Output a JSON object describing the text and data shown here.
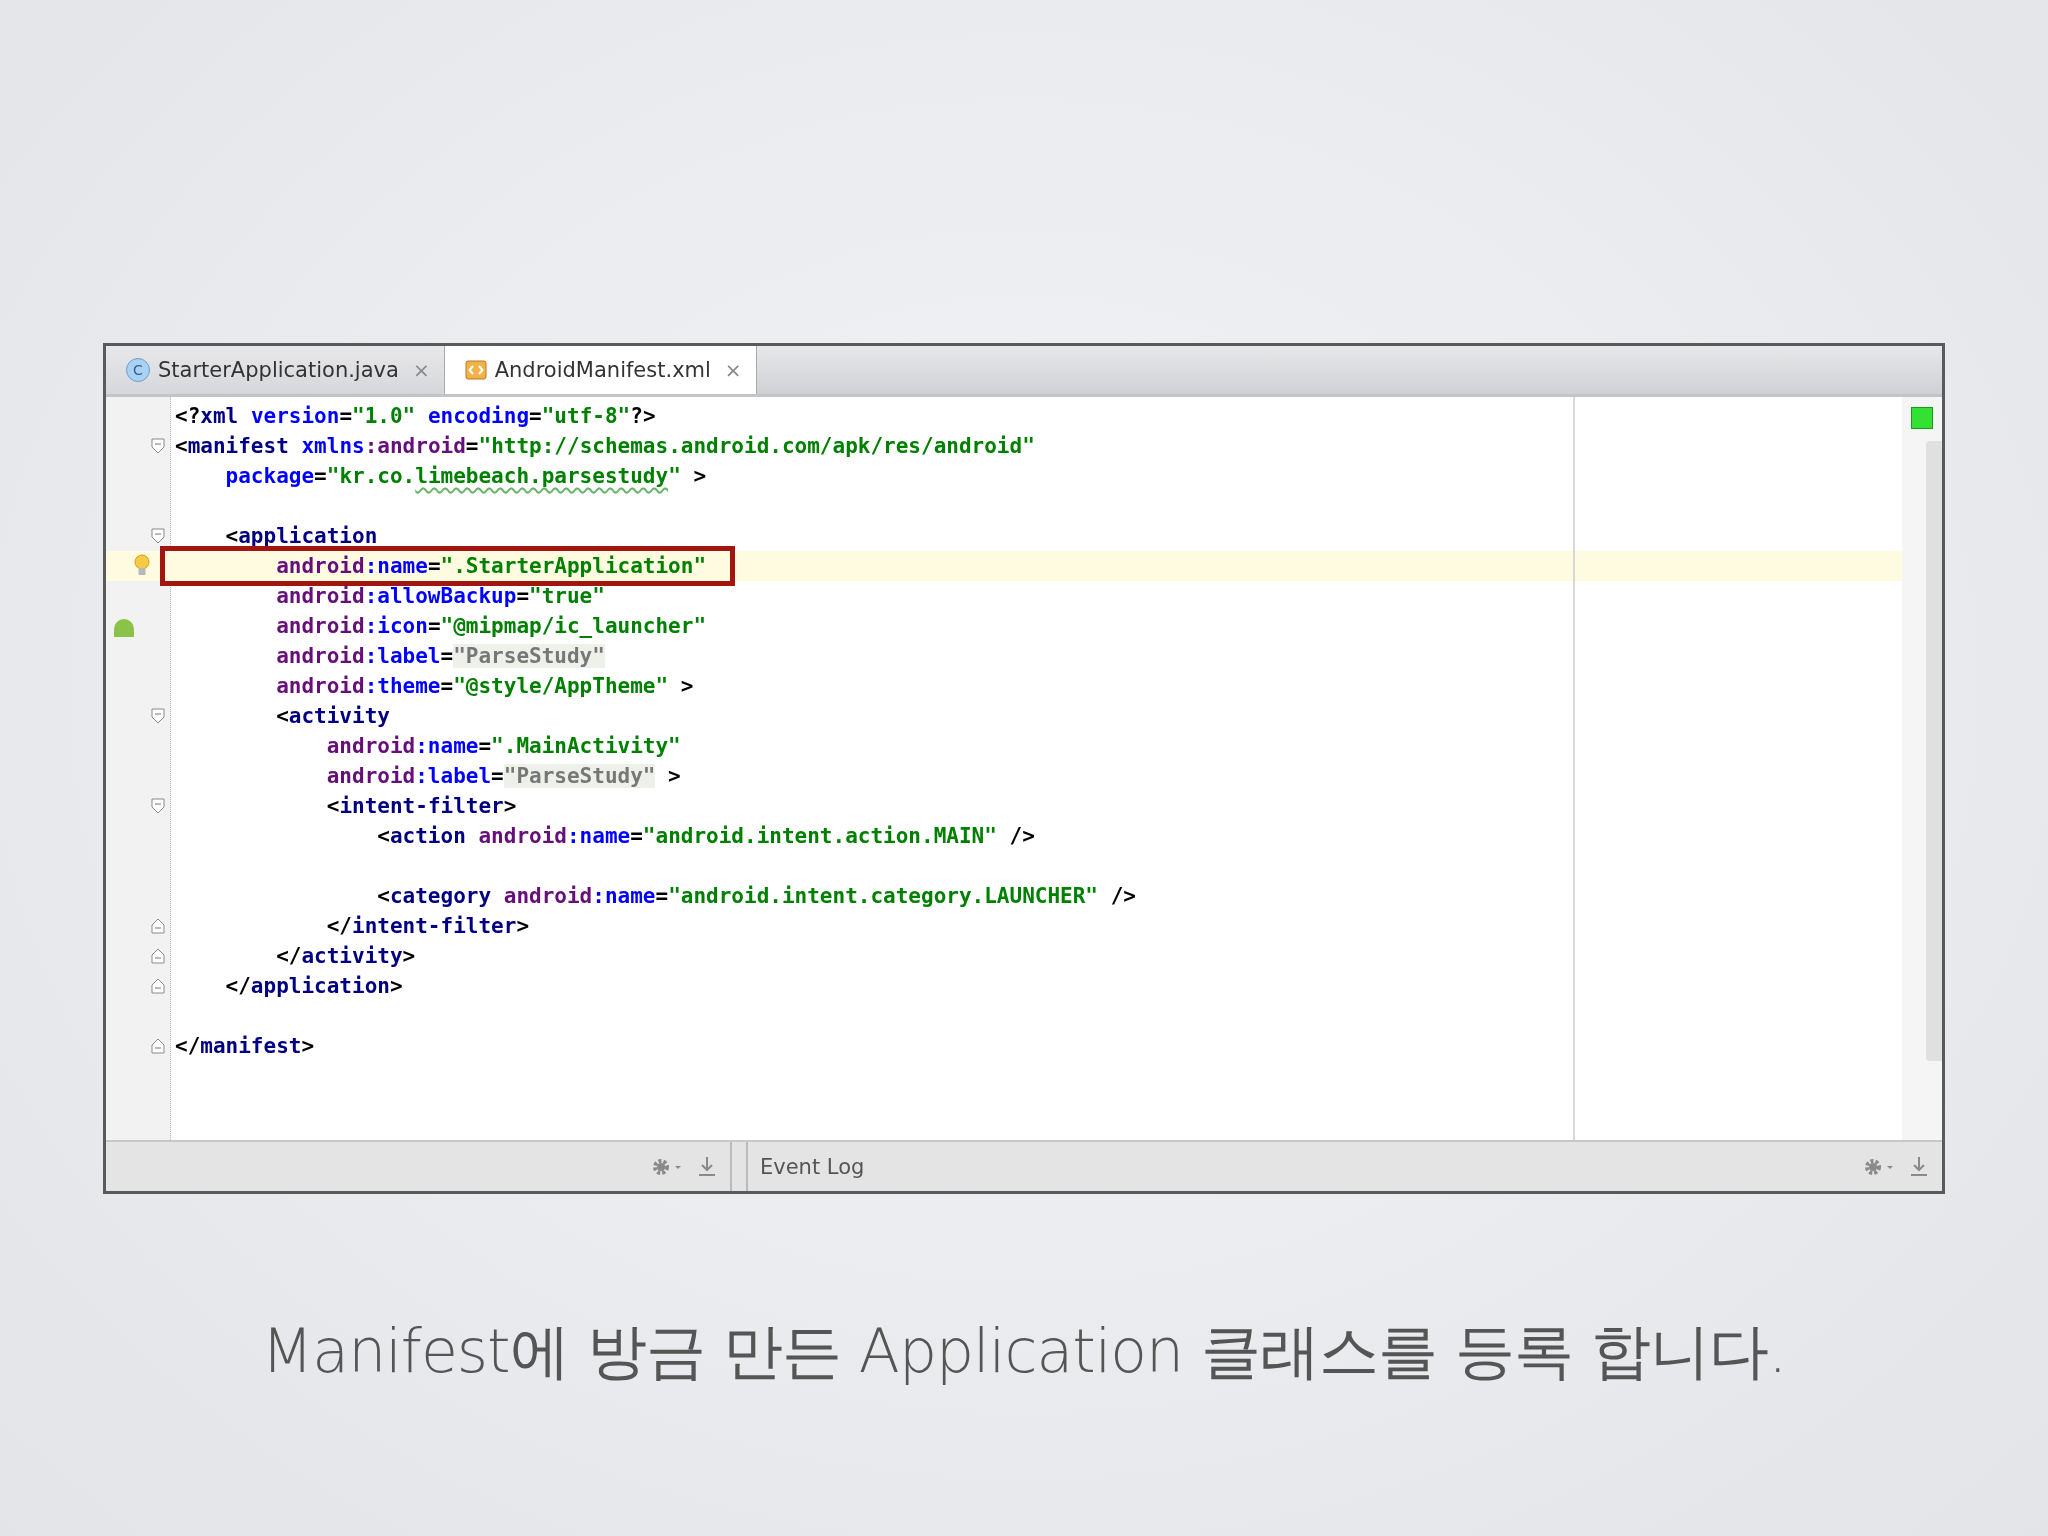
{
  "tabs": [
    {
      "label": "StarterApplication.java",
      "kind": "class",
      "icon_letter": "C",
      "close": "×",
      "selected": false
    },
    {
      "label": "AndroidManifest.xml",
      "kind": "xml",
      "close": "×",
      "selected": true
    }
  ],
  "editor": {
    "lines": [
      {
        "kind": "code",
        "segments": [
          {
            "text": "<?",
            "kind": "punct"
          },
          {
            "text": "xml ",
            "kind": "tag"
          },
          {
            "text": "version",
            "kind": "attr"
          },
          {
            "text": "=",
            "kind": "punct"
          },
          {
            "text": "\"1.0\" ",
            "kind": "value"
          },
          {
            "text": "encoding",
            "kind": "attr"
          },
          {
            "text": "=",
            "kind": "punct"
          },
          {
            "text": "\"utf-8\"",
            "kind": "value"
          },
          {
            "text": "?>",
            "kind": "punct"
          }
        ]
      },
      {
        "kind": "code",
        "fold_open": true,
        "segments": [
          {
            "text": "<",
            "kind": "punct"
          },
          {
            "text": "manifest ",
            "kind": "tag"
          },
          {
            "text": "xmlns",
            "kind": "attr"
          },
          {
            "text": ":android",
            "kind": "ns"
          },
          {
            "text": "=",
            "kind": "punct"
          },
          {
            "text": "\"http://schemas.android.com/apk/res/android\"",
            "kind": "value"
          }
        ]
      },
      {
        "kind": "code",
        "segments": [
          {
            "text": "    package",
            "kind": "attr"
          },
          {
            "text": "=",
            "kind": "punct"
          },
          {
            "text": "\"kr.co.",
            "kind": "value"
          },
          {
            "text": "limebeach.parsestudy",
            "kind": "value",
            "squiggle": true
          },
          {
            "text": "\"",
            "kind": "value"
          },
          {
            "text": " >",
            "kind": "punct"
          }
        ]
      },
      {
        "kind": "blank"
      },
      {
        "kind": "code",
        "fold_open": true,
        "segments": [
          {
            "text": "    <",
            "kind": "punct"
          },
          {
            "text": "application",
            "kind": "tag"
          }
        ]
      },
      {
        "kind": "code",
        "highlighted": true,
        "boxed": true,
        "bulb": true,
        "segments": [
          {
            "text": "        android",
            "kind": "ns"
          },
          {
            "text": ":name",
            "kind": "attr"
          },
          {
            "text": "=",
            "kind": "punct"
          },
          {
            "text": "\".StarterApplication\"",
            "kind": "value"
          }
        ]
      },
      {
        "kind": "code",
        "segments": [
          {
            "text": "        android",
            "kind": "ns"
          },
          {
            "text": ":allowBackup",
            "kind": "attr"
          },
          {
            "text": "=",
            "kind": "punct"
          },
          {
            "text": "\"true\"",
            "kind": "value"
          }
        ]
      },
      {
        "kind": "code",
        "android_icon": true,
        "segments": [
          {
            "text": "        android",
            "kind": "ns"
          },
          {
            "text": ":icon",
            "kind": "attr"
          },
          {
            "text": "=",
            "kind": "punct"
          },
          {
            "text": "\"@mipmap/ic_launcher\"",
            "kind": "value"
          }
        ]
      },
      {
        "kind": "code",
        "segments": [
          {
            "text": "        android",
            "kind": "ns"
          },
          {
            "text": ":label",
            "kind": "attr"
          },
          {
            "text": "=",
            "kind": "punct"
          },
          {
            "text": "\"ParseStudy\"",
            "kind": "muted"
          }
        ]
      },
      {
        "kind": "code",
        "segments": [
          {
            "text": "        android",
            "kind": "ns"
          },
          {
            "text": ":theme",
            "kind": "attr"
          },
          {
            "text": "=",
            "kind": "punct"
          },
          {
            "text": "\"@style/AppTheme\"",
            "kind": "value"
          },
          {
            "text": " >",
            "kind": "punct"
          }
        ]
      },
      {
        "kind": "code",
        "fold_open": true,
        "segments": [
          {
            "text": "        <",
            "kind": "punct"
          },
          {
            "text": "activity",
            "kind": "tag"
          }
        ]
      },
      {
        "kind": "code",
        "segments": [
          {
            "text": "            android",
            "kind": "ns"
          },
          {
            "text": ":name",
            "kind": "attr"
          },
          {
            "text": "=",
            "kind": "punct"
          },
          {
            "text": "\".MainActivity\"",
            "kind": "value"
          }
        ]
      },
      {
        "kind": "code",
        "segments": [
          {
            "text": "            android",
            "kind": "ns"
          },
          {
            "text": ":label",
            "kind": "attr"
          },
          {
            "text": "=",
            "kind": "punct"
          },
          {
            "text": "\"ParseStudy\"",
            "kind": "muted"
          },
          {
            "text": " >",
            "kind": "punct"
          }
        ]
      },
      {
        "kind": "code",
        "fold_open": true,
        "segments": [
          {
            "text": "            <",
            "kind": "punct"
          },
          {
            "text": "intent-filter",
            "kind": "tag"
          },
          {
            "text": ">",
            "kind": "punct"
          }
        ]
      },
      {
        "kind": "code",
        "segments": [
          {
            "text": "                <",
            "kind": "punct"
          },
          {
            "text": "action ",
            "kind": "tag"
          },
          {
            "text": "android",
            "kind": "ns"
          },
          {
            "text": ":name",
            "kind": "attr"
          },
          {
            "text": "=",
            "kind": "punct"
          },
          {
            "text": "\"android.intent.action.MAIN\"",
            "kind": "value"
          },
          {
            "text": " />",
            "kind": "punct"
          }
        ]
      },
      {
        "kind": "blank"
      },
      {
        "kind": "code",
        "segments": [
          {
            "text": "                <",
            "kind": "punct"
          },
          {
            "text": "category ",
            "kind": "tag"
          },
          {
            "text": "android",
            "kind": "ns"
          },
          {
            "text": ":name",
            "kind": "attr"
          },
          {
            "text": "=",
            "kind": "punct"
          },
          {
            "text": "\"android.intent.category.LAUNCHER\"",
            "kind": "value"
          },
          {
            "text": " />",
            "kind": "punct"
          }
        ]
      },
      {
        "kind": "code",
        "fold_close": true,
        "segments": [
          {
            "text": "            </",
            "kind": "punct"
          },
          {
            "text": "intent-filter",
            "kind": "tag"
          },
          {
            "text": ">",
            "kind": "punct"
          }
        ]
      },
      {
        "kind": "code",
        "fold_close": true,
        "segments": [
          {
            "text": "        </",
            "kind": "punct"
          },
          {
            "text": "activity",
            "kind": "tag"
          },
          {
            "text": ">",
            "kind": "punct"
          }
        ]
      },
      {
        "kind": "code",
        "fold_close": true,
        "segments": [
          {
            "text": "    </",
            "kind": "punct"
          },
          {
            "text": "application",
            "kind": "tag"
          },
          {
            "text": ">",
            "kind": "punct"
          }
        ]
      },
      {
        "kind": "blank"
      },
      {
        "kind": "code",
        "fold_close": true,
        "segments": [
          {
            "text": "</",
            "kind": "punct"
          },
          {
            "text": "manifest",
            "kind": "tag"
          },
          {
            "text": ">",
            "kind": "punct"
          }
        ]
      }
    ]
  },
  "bottom_bar": {
    "event_log": "Event Log"
  },
  "caption": "Manifest에 방금 만든 Application 클래스를 등록 합니다."
}
